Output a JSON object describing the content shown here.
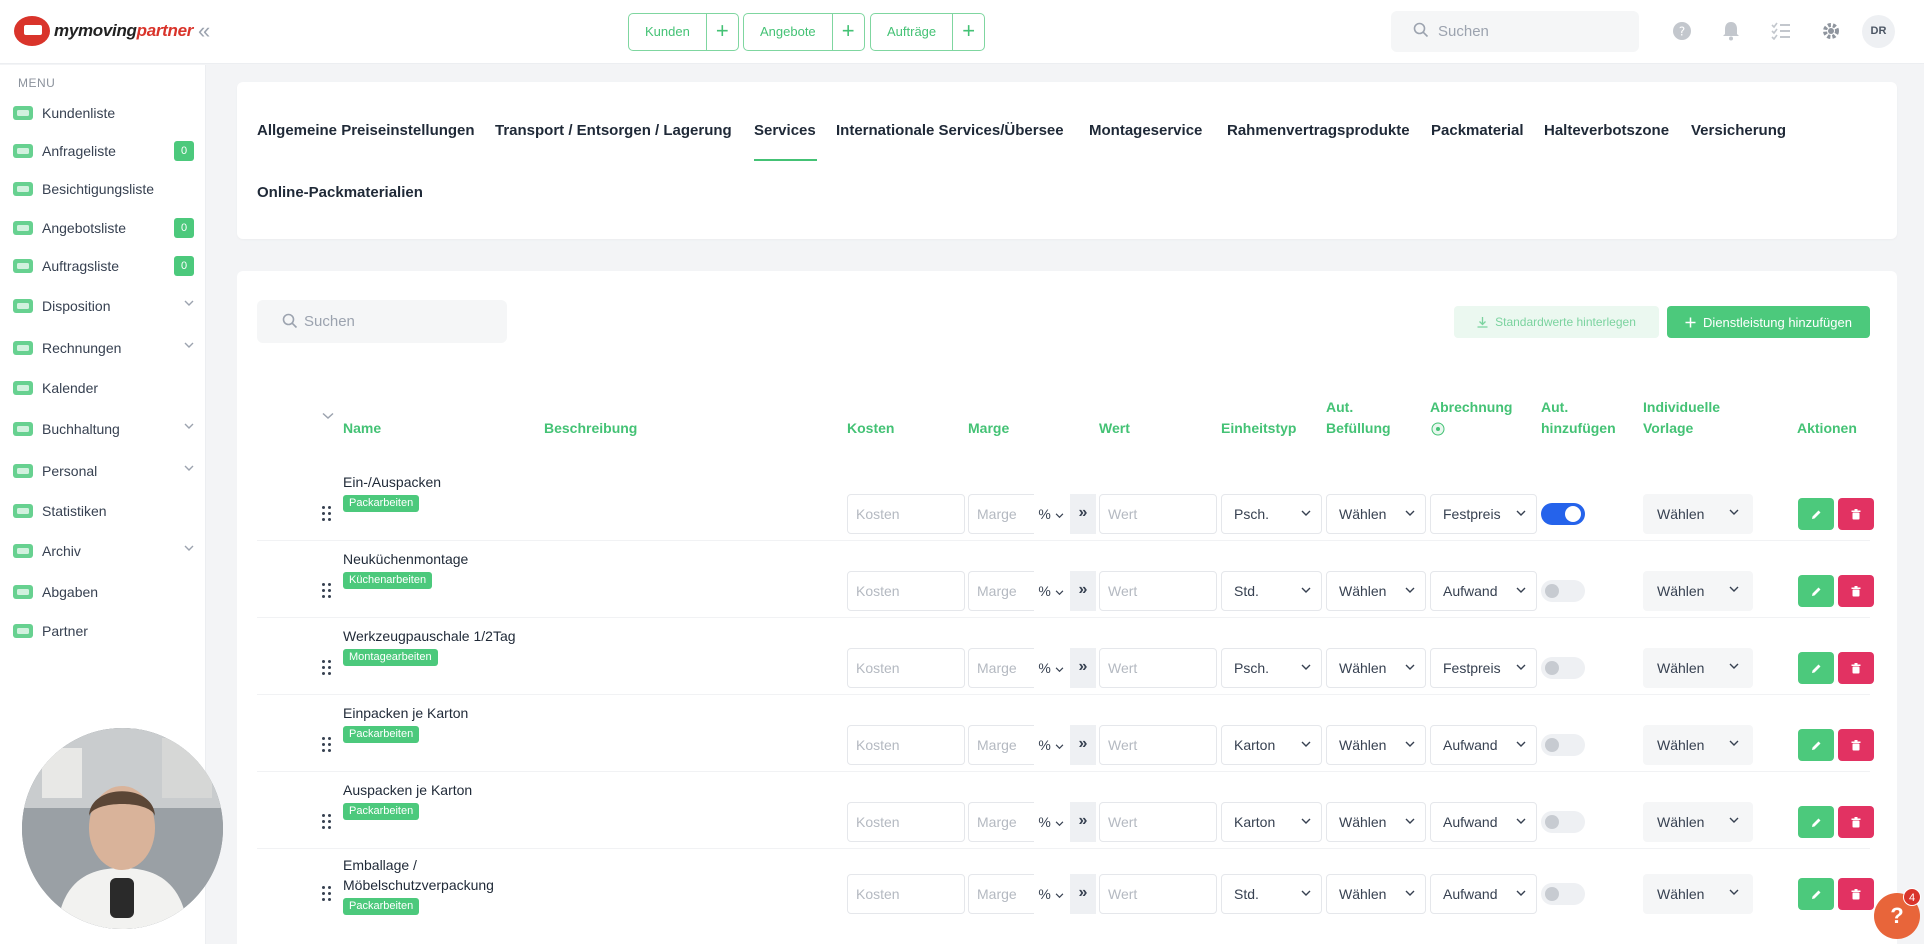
{
  "app": {
    "logo_part1": "mymoving",
    "logo_part2": "partner",
    "user_initials": "DR"
  },
  "quick_actions": [
    {
      "label": "Kunden"
    },
    {
      "label": "Angebote"
    },
    {
      "label": "Aufträge"
    }
  ],
  "top_search": {
    "placeholder": "Suchen"
  },
  "sidebar": {
    "menu_label": "MENU",
    "items": [
      {
        "label": "Kundenliste",
        "icon": "users-icon",
        "badge": null,
        "expandable": false
      },
      {
        "label": "Anfrageliste",
        "icon": "inbox-icon",
        "badge": "0",
        "expandable": false
      },
      {
        "label": "Besichtigungsliste",
        "icon": "house-icon",
        "badge": null,
        "expandable": false
      },
      {
        "label": "Angebotsliste",
        "icon": "document-icon",
        "badge": "0",
        "expandable": false
      },
      {
        "label": "Auftragsliste",
        "icon": "clipboard-icon",
        "badge": "0",
        "expandable": false
      },
      {
        "label": "Disposition",
        "icon": "dispatch-icon",
        "badge": null,
        "expandable": true
      },
      {
        "label": "Rechnungen",
        "icon": "money-icon",
        "badge": null,
        "expandable": true
      },
      {
        "label": "Kalender",
        "icon": "calendar-icon",
        "badge": null,
        "expandable": false
      },
      {
        "label": "Buchhaltung",
        "icon": "grid-icon",
        "badge": null,
        "expandable": true
      },
      {
        "label": "Personal",
        "icon": "person-icon",
        "badge": null,
        "expandable": true
      },
      {
        "label": "Statistiken",
        "icon": "chart-icon",
        "badge": null,
        "expandable": false
      },
      {
        "label": "Archiv",
        "icon": "archive-icon",
        "badge": null,
        "expandable": true
      },
      {
        "label": "Abgaben",
        "icon": "network-icon",
        "badge": null,
        "expandable": false
      },
      {
        "label": "Partner",
        "icon": "handshake-icon",
        "badge": null,
        "expandable": false
      }
    ]
  },
  "tabs": [
    {
      "label": "Allgemeine Preiseinstellungen",
      "active": false
    },
    {
      "label": "Transport / Entsorgen / Lagerung",
      "active": false
    },
    {
      "label": "Services",
      "active": true
    },
    {
      "label": "Internationale Services/Übersee",
      "active": false
    },
    {
      "label": "Montageservice",
      "active": false
    },
    {
      "label": "Rahmenvertragsprodukte",
      "active": false
    },
    {
      "label": "Packmaterial",
      "active": false
    },
    {
      "label": "Halteverbotszone",
      "active": false
    },
    {
      "label": "Versicherung",
      "active": false
    },
    {
      "label": "Online-Packmaterialien",
      "active": false
    }
  ],
  "services": {
    "search_placeholder": "Suchen",
    "btn_defaults": "Standardwerte hinterlegen",
    "btn_add": "Dienstleistung hinzufügen",
    "columns": {
      "name": "Name",
      "description": "Beschreibung",
      "cost": "Kosten",
      "margin": "Marge",
      "value": "Wert",
      "unit": "Einheitstyp",
      "autofill": "Aut. Befüllung",
      "billing": "Abrechnung",
      "autoadd": "Aut. hinzufügen",
      "template": "Individuelle Vorlage",
      "actions": "Aktionen"
    },
    "placeholders": {
      "cost": "Kosten",
      "margin": "Marge",
      "value": "Wert"
    },
    "margin_type": "%",
    "autofill_value": "Wählen",
    "template_value": "Wählen",
    "rows": [
      {
        "name": "Ein-/Auspacken",
        "category": "Packarbeiten",
        "unit": "Psch.",
        "billing": "Festpreis",
        "auto_add": true
      },
      {
        "name": "Neuküchenmontage",
        "category": "Küchenarbeiten",
        "unit": "Std.",
        "billing": "Aufwand",
        "auto_add": false
      },
      {
        "name": "Werkzeugpauschale 1/2Tag",
        "category": "Montagearbeiten",
        "unit": "Psch.",
        "billing": "Festpreis",
        "auto_add": false
      },
      {
        "name": "Einpacken je Karton",
        "category": "Packarbeiten",
        "unit": "Karton",
        "billing": "Aufwand",
        "auto_add": false
      },
      {
        "name": "Auspacken je Karton",
        "category": "Packarbeiten",
        "unit": "Karton",
        "billing": "Aufwand",
        "auto_add": false
      },
      {
        "name": "Emballage / Möbelschutzverpackung",
        "category": "Packarbeiten",
        "unit": "Std.",
        "billing": "Aufwand",
        "auto_add": false
      }
    ]
  },
  "help": {
    "label": "?",
    "badge": "4"
  },
  "colors": {
    "accent": "#44c275",
    "accent_fill": "#4cc97c",
    "danger": "#e23262",
    "toggle_on": "#2563eb",
    "brand_red": "#d9342b"
  }
}
